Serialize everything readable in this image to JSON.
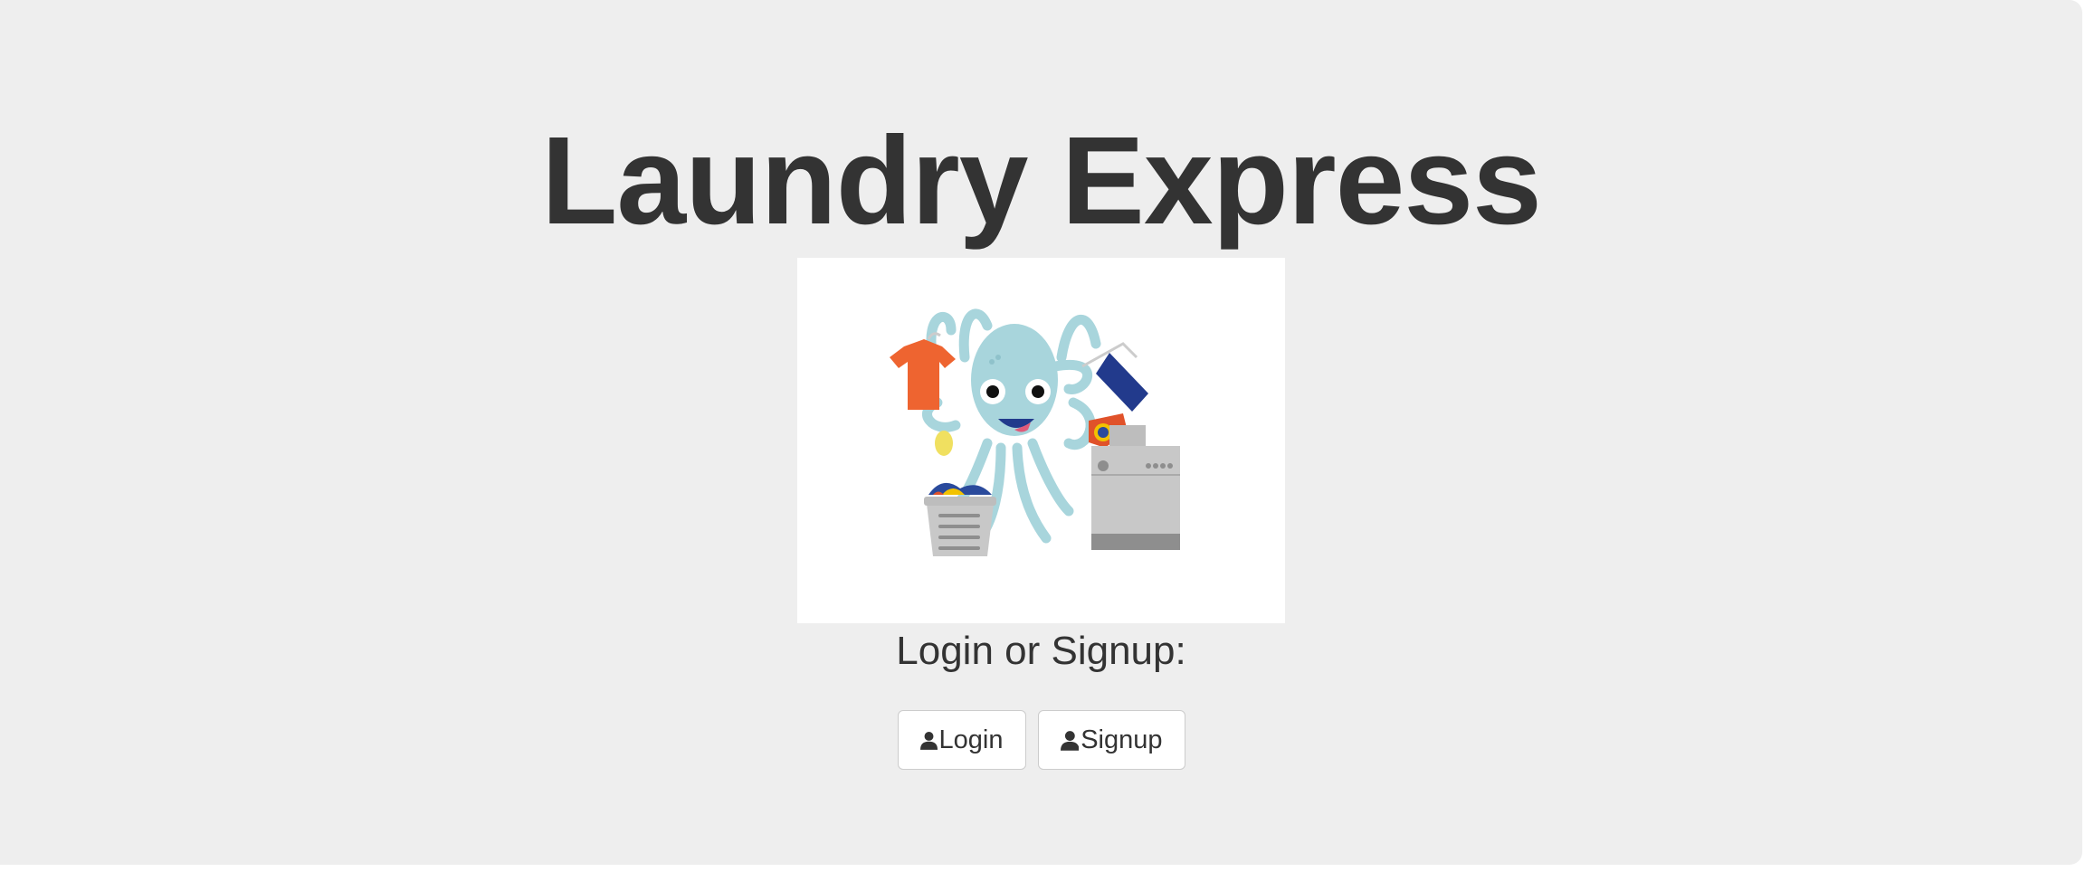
{
  "header": {
    "title": "Laundry Express"
  },
  "main": {
    "prompt": "Login or Signup:",
    "illustration_icon": "octopus-doing-laundry-illustration",
    "buttons": {
      "login_label": "Login",
      "signup_label": "Signup",
      "icon": "user-icon"
    }
  },
  "colors": {
    "background": "#eeeeee",
    "text": "#333333",
    "octopus": "#a8d5dc",
    "shirt": "#ee6430",
    "towel": "#223a8c",
    "washer": "#c8c8c8"
  }
}
